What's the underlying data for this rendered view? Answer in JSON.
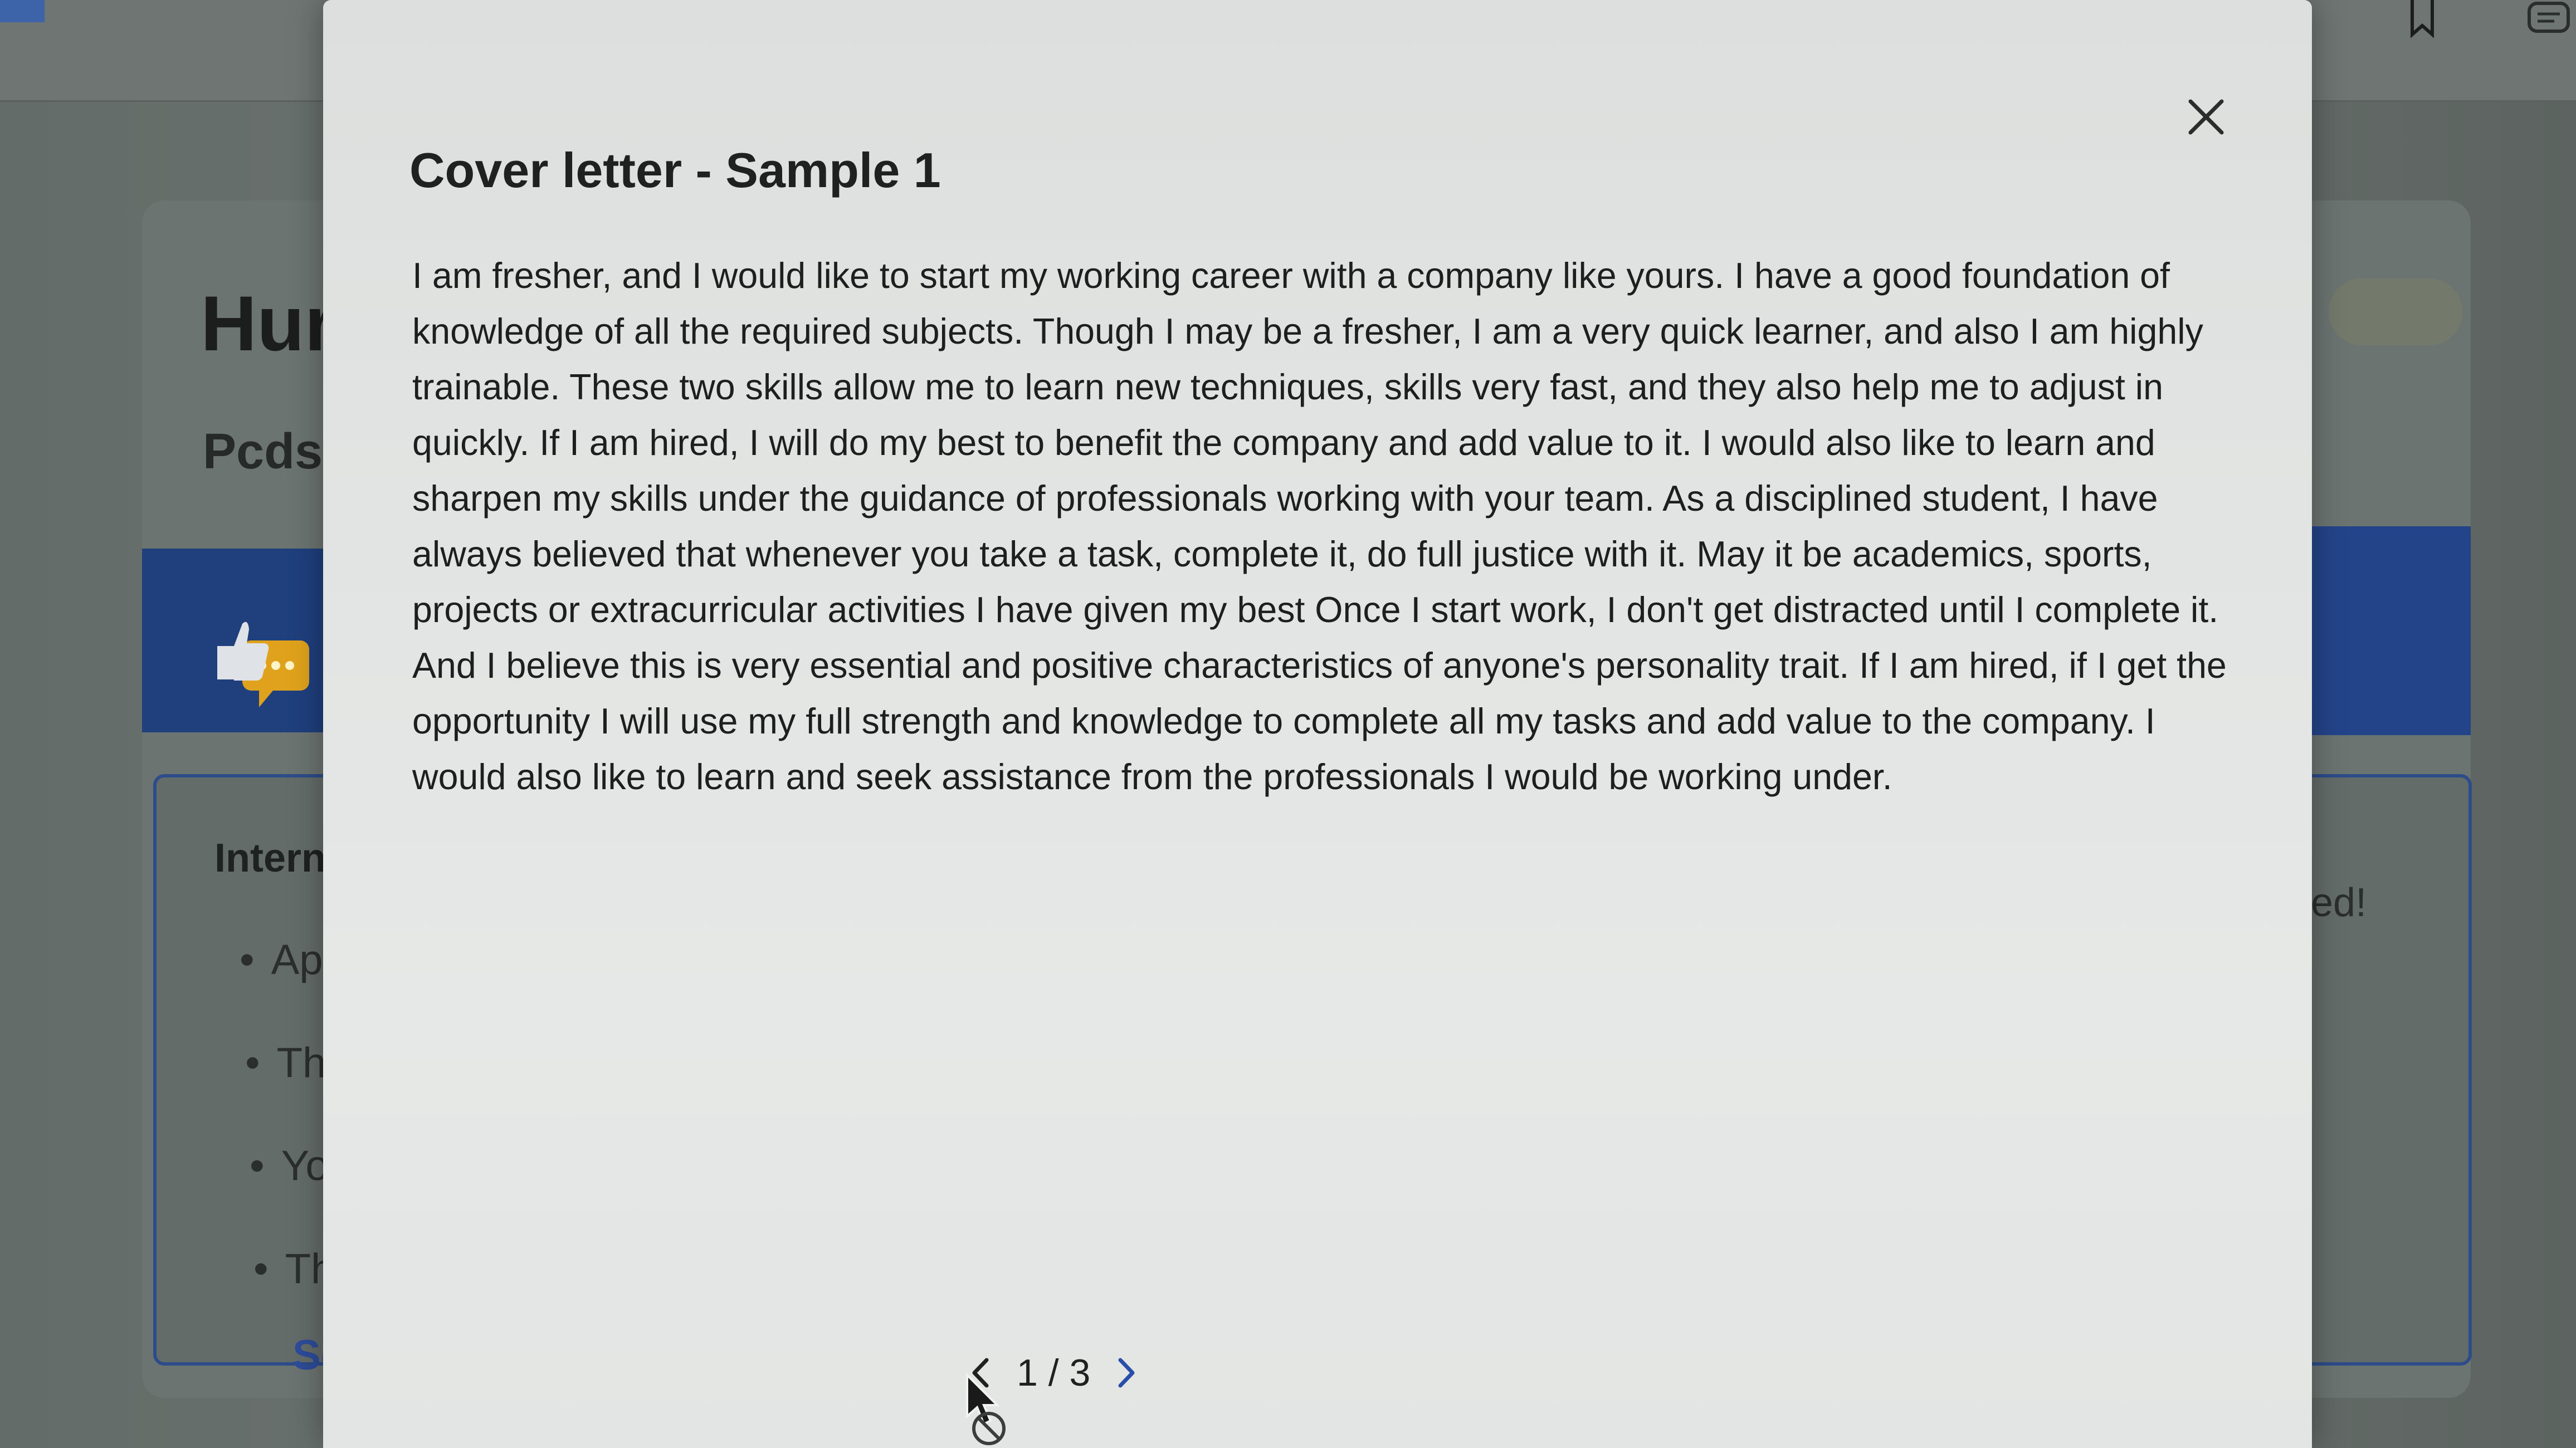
{
  "background": {
    "job_title_partial": "Hur",
    "company_partial": "Pcds",
    "section_heading_partial": "Intern",
    "bullets_partial": [
      "Ap",
      "Thi",
      "You",
      "Th"
    ],
    "link_partial": "Se",
    "right_snippet_partial": "ed!"
  },
  "modal": {
    "title": "Cover letter - Sample 1",
    "body": "I am fresher, and I would like to start my working career with a company like yours. I have a good foundation of knowledge of all the required subjects. Though I may be a fresher, I am a very quick learner, and also I am highly trainable. These two skills allow me to learn new techniques, skills very fast, and they also help me to adjust in quickly. If I am hired, I will do my best to benefit the company and add value to it. I would also like to learn and sharpen my skills under the guidance of professionals working with your team. As a disciplined student, I have always believed that whenever you take a task, complete it, do full justice with it. May it be academics, sports, projects or extracurricular activities I have given my best Once I start work, I don't get distracted until I complete it. And I believe this is very essential and positive characteristics of anyone's personality trait. If I am hired, if I get the opportunity I will use my full strength and knowledge to complete all my tasks and add value to the company. I would also like to learn and seek assistance from the professionals I would be working under.",
    "close_icon": "close-icon"
  },
  "pagination": {
    "current": "1",
    "total": "3",
    "status": "1 / 3",
    "prev_icon": "chevron-left-icon",
    "next_icon": "chevron-right-icon"
  },
  "colors": {
    "modal_bg": "#e2e4e3",
    "backdrop": "#6c7471",
    "accent_blue": "#2a4fa8",
    "banner_blue": "#1f3f7d",
    "text": "#1c1f1e"
  }
}
